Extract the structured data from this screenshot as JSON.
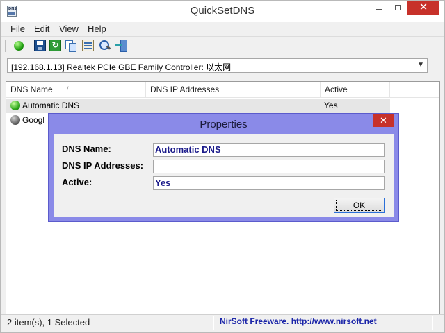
{
  "window": {
    "title": "QuickSetDNS",
    "app_icon_label": "DNS",
    "controls": {
      "minimize": "",
      "maximize": "",
      "close": "✕"
    }
  },
  "menu": [
    "File",
    "Edit",
    "View",
    "Help"
  ],
  "toolbar": {
    "buttons": [
      {
        "name": "activate-dns",
        "icon": "green-circle-icon"
      },
      {
        "name": "save",
        "icon": "floppy-disk-icon"
      },
      {
        "name": "refresh",
        "icon": "refresh-icon"
      },
      {
        "name": "copy",
        "icon": "copy-icon"
      },
      {
        "name": "properties",
        "icon": "properties-icon"
      },
      {
        "name": "find",
        "icon": "search-icon"
      },
      {
        "name": "exit",
        "icon": "exit-icon"
      }
    ]
  },
  "adapter": {
    "selected": "[192.168.1.13]  Realtek PCIe GBE Family Controller: 以太网",
    "arrow": "▼"
  },
  "list": {
    "columns": [
      "DNS Name",
      "DNS IP Addresses",
      "Active"
    ],
    "sort_indicator": "/",
    "rows": [
      {
        "name": "Automatic DNS",
        "ip": "",
        "active": "Yes",
        "status": "green"
      },
      {
        "name": "Googl",
        "ip": "",
        "active": "",
        "status": "gray"
      }
    ]
  },
  "status": {
    "items": "2 item(s), 1 Selected",
    "credit": "NirSoft Freeware.  http://www.nirsoft.net"
  },
  "dialog": {
    "title": "Properties",
    "close": "✕",
    "fields": [
      {
        "label": "DNS Name:",
        "value": "Automatic DNS"
      },
      {
        "label": "DNS IP Addresses:",
        "value": ""
      },
      {
        "label": "Active:",
        "value": "Yes"
      }
    ],
    "ok_label": "OK"
  }
}
